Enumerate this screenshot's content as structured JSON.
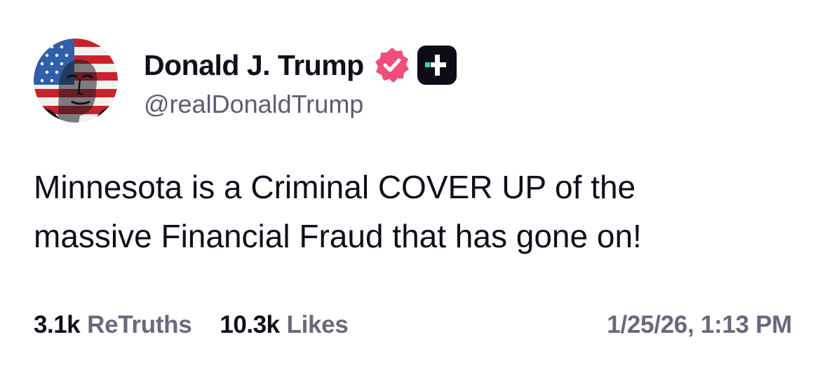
{
  "author": {
    "display_name": "Donald J. Trump",
    "handle": "@realDonaldTrump",
    "avatar_icon": "flag-portrait-avatar",
    "verified_icon": "verified-badge-icon",
    "verified_color": "#f04e7b",
    "plus_icon": "truth-plus-icon",
    "plus_accent": "#2ee0b0"
  },
  "post": {
    "lines": [
      "Minnesota is a Criminal COVER UP of the",
      "massive Financial Fraud that has gone on!"
    ]
  },
  "stats": {
    "retruths_count": "3.1k",
    "retruths_label": "ReTruths",
    "likes_count": "10.3k",
    "likes_label": "Likes"
  },
  "timestamp": "1/25/26, 1:13 PM"
}
